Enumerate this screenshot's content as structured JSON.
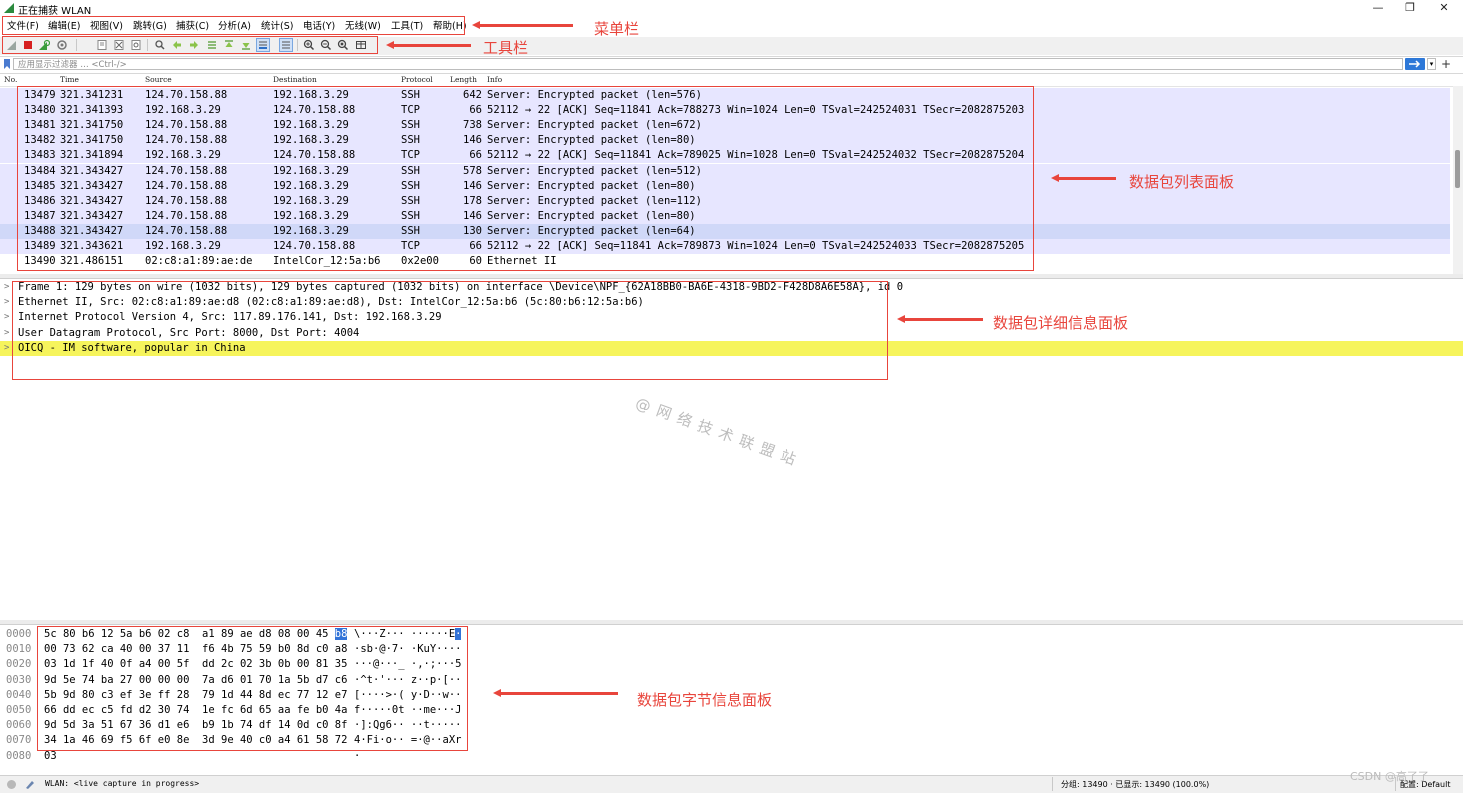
{
  "window": {
    "title": "正在捕获 WLAN",
    "minimize": "—",
    "restore": "❐",
    "close": "✕"
  },
  "menu": [
    "文件(F)",
    "编辑(E)",
    "视图(V)",
    "跳转(G)",
    "捕获(C)",
    "分析(A)",
    "统计(S)",
    "电话(Y)",
    "无线(W)",
    "工具(T)",
    "帮助(H)"
  ],
  "toolbar": {
    "icons": [
      "shark-fin-start-icon",
      "stop-capture-icon",
      "restart-capture-icon",
      "capture-options-icon",
      "open-file-icon",
      "save-file-icon",
      "close-file-icon",
      "reload-icon",
      "find-packet-icon",
      "go-back-icon",
      "go-forward-icon",
      "go-to-packet-icon",
      "go-first-icon",
      "go-last-icon",
      "autoscroll-icon",
      "colorize-icon",
      "zoom-in-icon",
      "zoom-out-icon",
      "normal-size-icon",
      "resize-columns-icon"
    ]
  },
  "filter": {
    "placeholder": "应用显示过滤器 … <Ctrl-/>"
  },
  "packet_list": {
    "columns": [
      "No.",
      "Time",
      "Source",
      "Destination",
      "Protocol",
      "Length",
      "Info"
    ],
    "rows": [
      {
        "no": "13479",
        "time": "321.341231",
        "src": "124.70.158.88",
        "dst": "192.168.3.29",
        "proto": "SSH",
        "len": "642",
        "info": "Server: Encrypted packet (len=576)"
      },
      {
        "no": "13480",
        "time": "321.341393",
        "src": "192.168.3.29",
        "dst": "124.70.158.88",
        "proto": "TCP",
        "len": "66",
        "info": "52112 → 22 [ACK] Seq=11841 Ack=788273 Win=1024 Len=0 TSval=242524031 TSecr=2082875203"
      },
      {
        "no": "13481",
        "time": "321.341750",
        "src": "124.70.158.88",
        "dst": "192.168.3.29",
        "proto": "SSH",
        "len": "738",
        "info": "Server: Encrypted packet (len=672)"
      },
      {
        "no": "13482",
        "time": "321.341750",
        "src": "124.70.158.88",
        "dst": "192.168.3.29",
        "proto": "SSH",
        "len": "146",
        "info": "Server: Encrypted packet (len=80)"
      },
      {
        "no": "13483",
        "time": "321.341894",
        "src": "192.168.3.29",
        "dst": "124.70.158.88",
        "proto": "TCP",
        "len": "66",
        "info": "52112 → 22 [ACK] Seq=11841 Ack=789025 Win=1028 Len=0 TSval=242524032 TSecr=2082875204"
      },
      {
        "no": "13484",
        "time": "321.343427",
        "src": "124.70.158.88",
        "dst": "192.168.3.29",
        "proto": "SSH",
        "len": "578",
        "info": "Server: Encrypted packet (len=512)"
      },
      {
        "no": "13485",
        "time": "321.343427",
        "src": "124.70.158.88",
        "dst": "192.168.3.29",
        "proto": "SSH",
        "len": "146",
        "info": "Server: Encrypted packet (len=80)"
      },
      {
        "no": "13486",
        "time": "321.343427",
        "src": "124.70.158.88",
        "dst": "192.168.3.29",
        "proto": "SSH",
        "len": "178",
        "info": "Server: Encrypted packet (len=112)"
      },
      {
        "no": "13487",
        "time": "321.343427",
        "src": "124.70.158.88",
        "dst": "192.168.3.29",
        "proto": "SSH",
        "len": "146",
        "info": "Server: Encrypted packet (len=80)"
      },
      {
        "no": "13488",
        "time": "321.343427",
        "src": "124.70.158.88",
        "dst": "192.168.3.29",
        "proto": "SSH",
        "len": "130",
        "info": "Server: Encrypted packet (len=64)"
      },
      {
        "no": "13489",
        "time": "321.343621",
        "src": "192.168.3.29",
        "dst": "124.70.158.88",
        "proto": "TCP",
        "len": "66",
        "info": "52112 → 22 [ACK] Seq=11841 Ack=789873 Win=1024 Len=0 TSval=242524033 TSecr=2082875205"
      },
      {
        "no": "13490",
        "time": "321.486151",
        "src": "02:c8:a1:89:ae:de",
        "dst": "IntelCor_12:5a:b6",
        "proto": "0x2e00",
        "len": "60",
        "info": "Ethernet II"
      }
    ]
  },
  "details": {
    "rows": [
      "Frame 1: 129 bytes on wire (1032 bits), 129 bytes captured (1032 bits) on interface \\Device\\NPF_{62A18BB0-BA6E-4318-9BD2-F428D8A6E58A}, id 0",
      "Ethernet II, Src: 02:c8:a1:89:ae:d8 (02:c8:a1:89:ae:d8), Dst: IntelCor_12:5a:b6 (5c:80:b6:12:5a:b6)",
      "Internet Protocol Version 4, Src: 117.89.176.141, Dst: 192.168.3.29",
      "User Datagram Protocol, Src Port: 8000, Dst Port: 4004",
      "OICQ - IM software, popular in China"
    ],
    "arrow": ">"
  },
  "bytes": {
    "rows": [
      {
        "off": "0000",
        "hex": "5c 80 b6 12 5a b6 02 c8  a1 89 ae d8 08 00 45 ",
        "hl": "b8",
        "asc": "\\···Z··· ······E",
        "asc_hl": "·"
      },
      {
        "off": "0010",
        "hex": "00 73 62 ca 40 00 37 11  f6 4b 75 59 b0 8d c0 a8",
        "asc": "·sb·@·7· ·KuY····"
      },
      {
        "off": "0020",
        "hex": "03 1d 1f 40 0f a4 00 5f  dd 2c 02 3b 0b 00 81 35",
        "asc": "···@···_ ·,·;···5"
      },
      {
        "off": "0030",
        "hex": "9d 5e 74 ba 27 00 00 00  7a d6 01 70 1a 5b d7 c6",
        "asc": "·^t·'··· z··p·[··"
      },
      {
        "off": "0040",
        "hex": "5b 9d 80 c3 ef 3e ff 28  79 1d 44 8d ec 77 12 e7",
        "asc": "[····>·( y·D··w··"
      },
      {
        "off": "0050",
        "hex": "66 dd ec c5 fd d2 30 74  1e fc 6d 65 aa fe b0 4a",
        "asc": "f·····0t ··me···J"
      },
      {
        "off": "0060",
        "hex": "9d 5d 3a 51 67 36 d1 e6  b9 1b 74 df 14 0d c0 8f",
        "asc": "·]:Qg6·· ··t·····"
      },
      {
        "off": "0070",
        "hex": "34 1a 46 69 f5 6f e0 8e  3d 9e 40 c0 a4 61 58 72",
        "asc": "4·Fi·o·· =·@··aXr"
      },
      {
        "off": "0080",
        "hex": "03",
        "asc": "·"
      }
    ]
  },
  "status": {
    "interface": "WLAN: <live capture in progress>",
    "groups": "分组: 13490 · 已显示: 13490 (100.0%)",
    "profile": "配置: Default"
  },
  "annotations": {
    "menubar": "菜单栏",
    "toolbar": "工具栏",
    "list": "数据包列表面板",
    "details": "数据包详细信息面板",
    "bytes": "数据包字节信息面板"
  },
  "watermark": "@网络技术联盟站",
  "csdn": "CSDN @高了了",
  "colors": {
    "row_bg": "#e7e6ff",
    "row_selected": "#d0d8f8",
    "row_white": "#ffffff",
    "oicq_highlight": "#f6f45c",
    "annotation_red": "#e8453c",
    "wireshark_green": "#2b8a3e"
  }
}
